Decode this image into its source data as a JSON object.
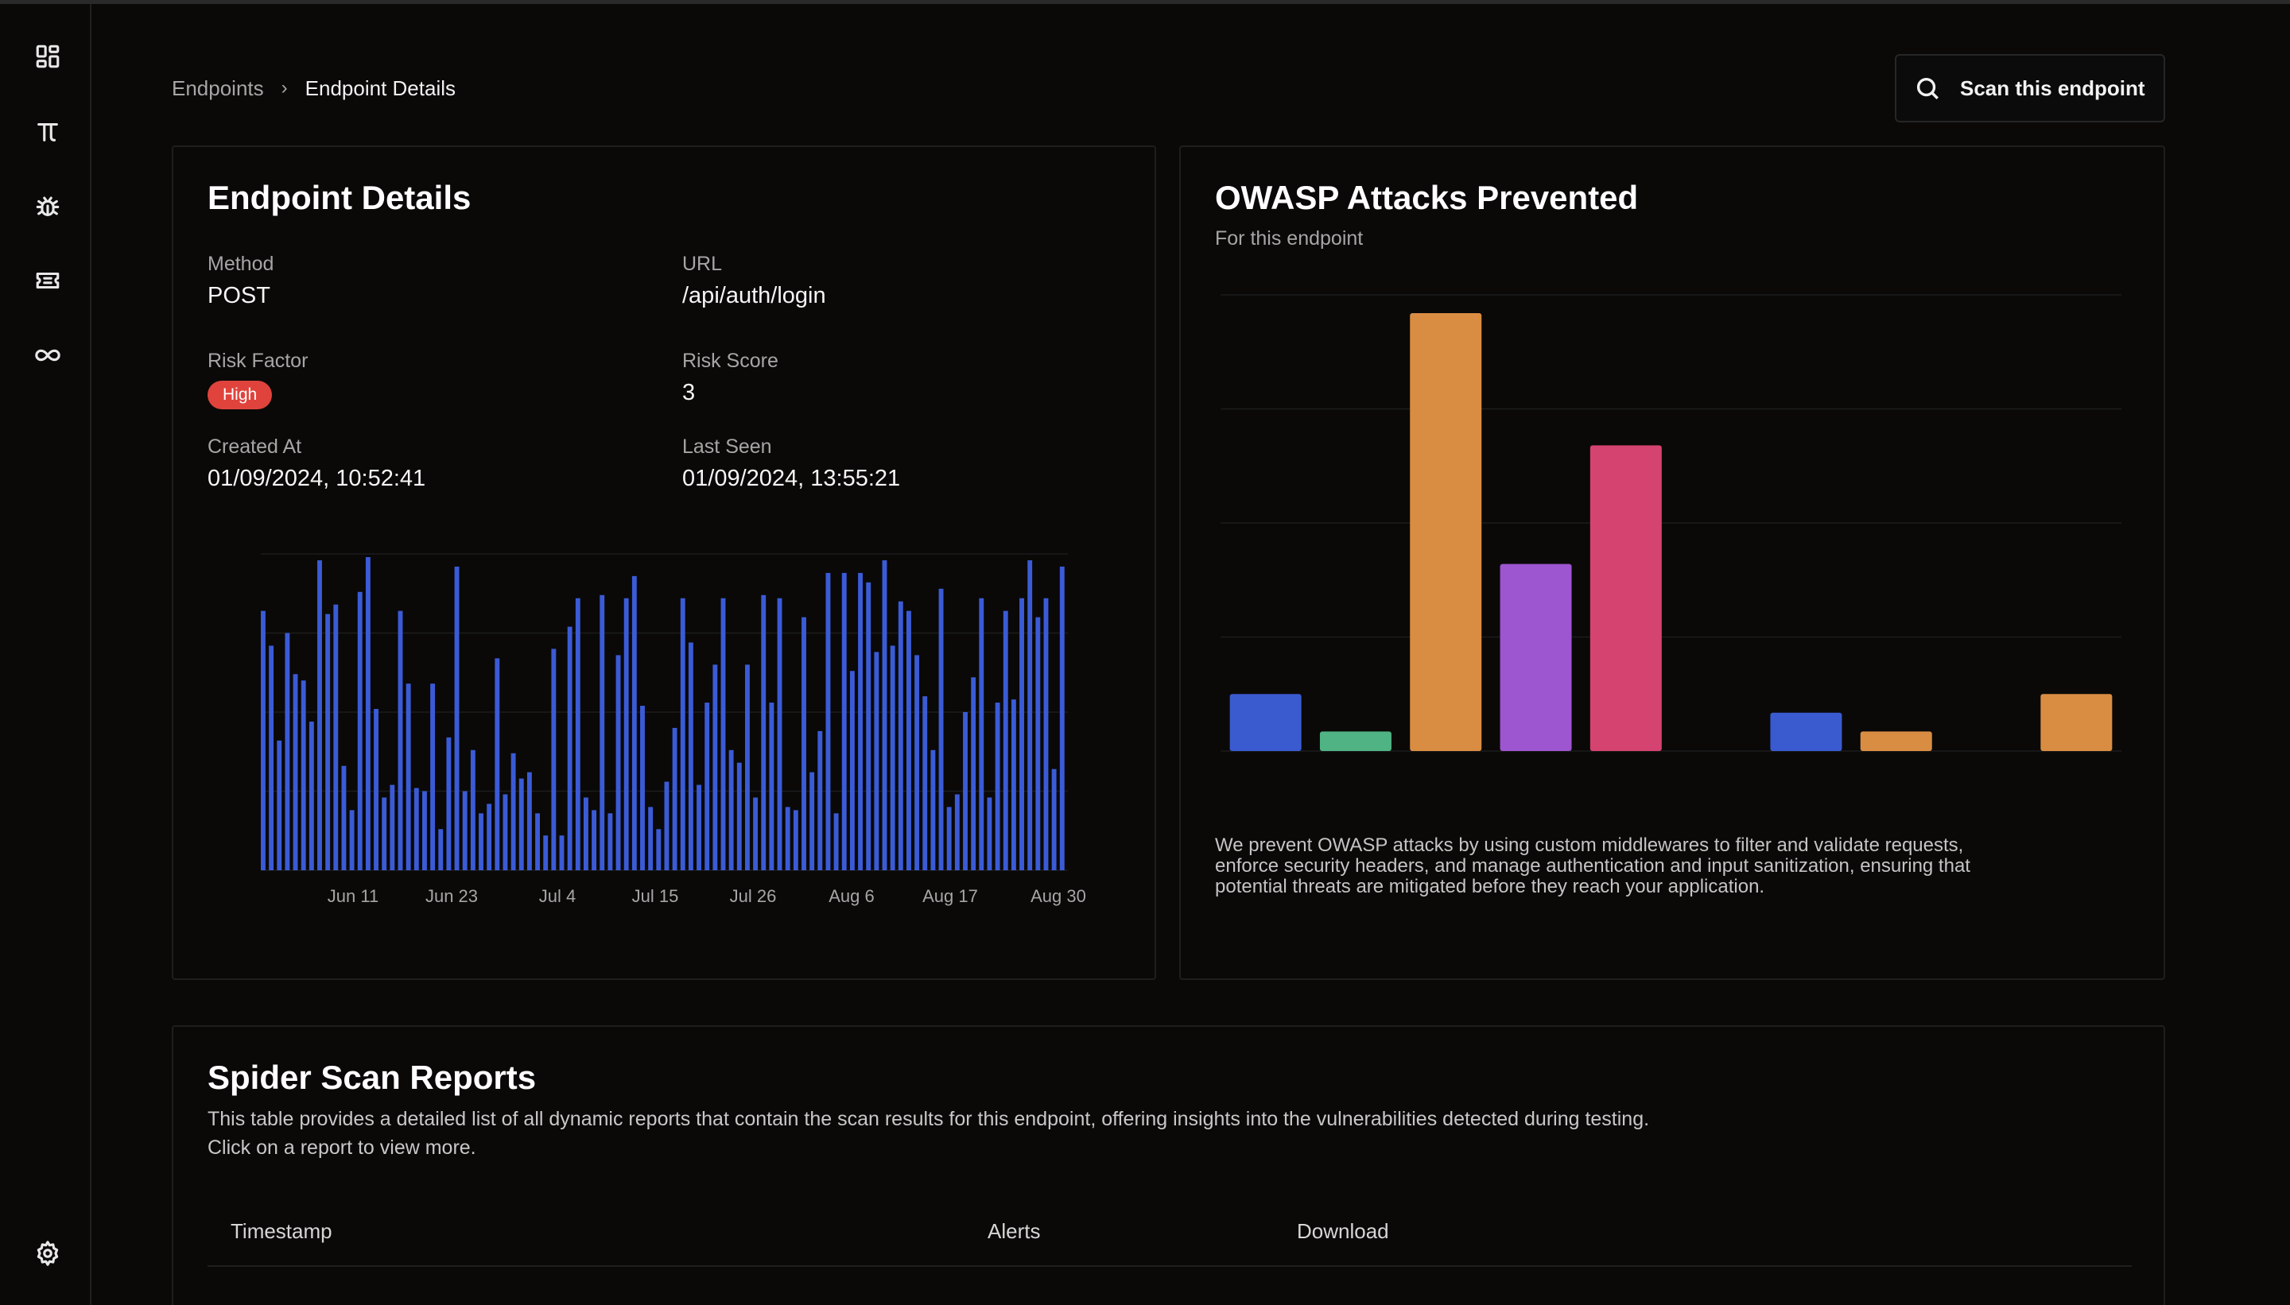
{
  "sidebar": {
    "items": [
      {
        "icon": "dashboard-icon"
      },
      {
        "icon": "pi-icon"
      },
      {
        "icon": "bug-icon"
      },
      {
        "icon": "ticket-icon"
      },
      {
        "icon": "infinity-icon"
      }
    ],
    "settings_icon": "gear-icon"
  },
  "breadcrumb": {
    "parent": "Endpoints",
    "separator": "›",
    "current": "Endpoint Details"
  },
  "scan_button": {
    "label": "Scan this endpoint",
    "icon": "search-icon"
  },
  "details": {
    "title": "Endpoint Details",
    "method_label": "Method",
    "method_value": "POST",
    "url_label": "URL",
    "url_value": "/api/auth/login",
    "risk_factor_label": "Risk Factor",
    "risk_factor_value": "High",
    "risk_score_label": "Risk Score",
    "risk_score_value": "3",
    "created_label": "Created At",
    "created_value": "01/09/2024, 10:52:41",
    "last_seen_label": "Last Seen",
    "last_seen_value": "01/09/2024, 13:55:21"
  },
  "owasp": {
    "title": "OWASP Attacks Prevented",
    "subtitle": "For this endpoint",
    "description_line1": "We prevent OWASP attacks by using custom middlewares to filter and validate requests,",
    "description_line2": "enforce security headers, and manage authentication and input sanitization, ensuring that",
    "description_line3": "potential threats are mitigated before they reach your application."
  },
  "spider": {
    "title": "Spider Scan Reports",
    "description_line1": "This table provides a detailed list of all dynamic reports that contain the scan results for this endpoint, offering insights into the vulnerabilities detected during testing.",
    "description_line2": "Click on a report to view more.",
    "columns": [
      "Timestamp",
      "Alerts",
      "Download"
    ]
  },
  "colors": {
    "activity_bar": "#3b5bd6",
    "badge_high": "#e0433c"
  },
  "chart_data": [
    {
      "type": "bar",
      "name": "activity",
      "xtick_labels": [
        "Jun 11",
        "Jun 23",
        "Jul 4",
        "Jul 15",
        "Jul 26",
        "Aug 6",
        "Aug 17",
        "Aug 30"
      ],
      "ylim": [
        0,
        100
      ],
      "grid": true,
      "values": [
        82,
        71,
        41,
        75,
        62,
        60,
        47,
        98,
        81,
        84,
        33,
        19,
        88,
        99,
        51,
        23,
        27,
        82,
        59,
        26,
        25,
        59,
        13,
        42,
        96,
        25,
        38,
        18,
        21,
        67,
        24,
        37,
        29,
        31,
        18,
        11,
        70,
        11,
        77,
        86,
        23,
        19,
        87,
        18,
        68,
        86,
        93,
        52,
        20,
        13,
        28,
        45,
        86,
        72,
        27,
        53,
        65,
        86,
        38,
        34,
        65,
        23,
        87,
        53,
        86,
        20,
        19,
        80,
        31,
        44,
        94,
        18,
        94,
        63,
        94,
        91,
        69,
        98,
        71,
        85,
        82,
        68,
        55,
        38,
        89,
        20,
        24,
        50,
        61,
        86,
        23,
        53,
        82,
        54,
        86,
        98,
        80,
        86,
        32,
        96
      ],
      "bar_color": "#3b5bd6"
    },
    {
      "type": "bar",
      "name": "owasp",
      "ylim": [
        0,
        100
      ],
      "grid": true,
      "values": [
        12.5,
        4.3,
        96,
        41,
        67,
        0,
        8.4,
        4.3,
        0,
        12.5
      ],
      "colors": [
        "#3a5bd0",
        "#4fb384",
        "#d98d43",
        "#9d55d0",
        "#d54370",
        "#000000",
        "#3a5bd0",
        "#d98d43",
        "#000000",
        "#d98d43"
      ]
    }
  ]
}
